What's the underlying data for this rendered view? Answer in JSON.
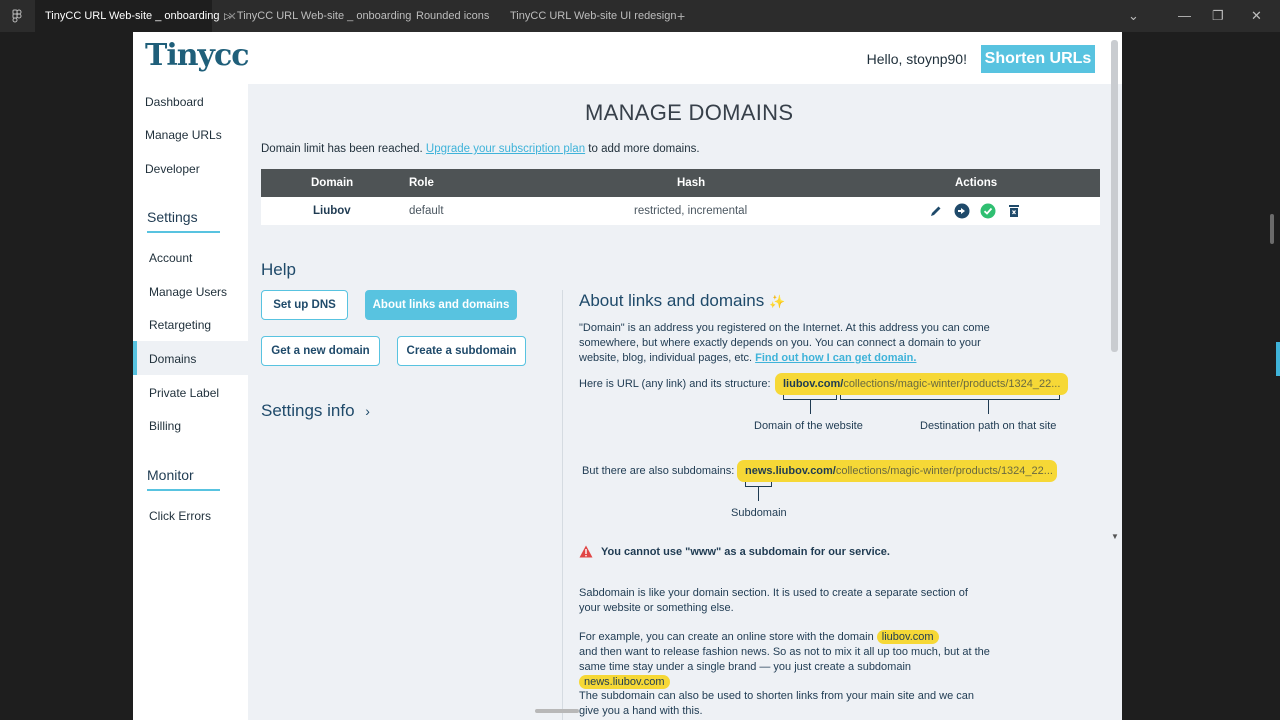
{
  "tabs": [
    {
      "label": "TinyCC URL Web-site _ onboarding",
      "active": true
    },
    {
      "label": "TinyCC URL Web-site _ onboarding",
      "active": false
    },
    {
      "label": "Rounded icons",
      "active": false
    },
    {
      "label": "TinyCC URL Web-site UI redesign",
      "active": false
    }
  ],
  "header": {
    "logo": "Tinycc",
    "greeting": "Hello, stoynp90!",
    "shorten_label": "Shorten URLs"
  },
  "sidebar": {
    "top_items": [
      "Dashboard",
      "Manage URLs",
      "Developer"
    ],
    "settings_title": "Settings",
    "settings_items": [
      "Account",
      "Manage Users",
      "Retargeting",
      "Domains",
      "Private Label",
      "Billing"
    ],
    "monitor_title": "Monitor",
    "monitor_items": [
      "Click Errors"
    ]
  },
  "main": {
    "title": "MANAGE DOMAINS",
    "notice_prefix": "Domain limit has been reached. ",
    "notice_link": "Upgrade your subscription plan",
    "notice_suffix": " to add more domains."
  },
  "table": {
    "headers": [
      "Domain",
      "Role",
      "Hash",
      "Actions"
    ],
    "rows": [
      {
        "domain": "Liubov",
        "role": "default",
        "hash": "restricted, incremental"
      }
    ]
  },
  "help": {
    "title": "Help",
    "buttons": [
      "Set up DNS",
      "About links and domains",
      "Get a new domain",
      "Create a subdomain"
    ],
    "settings_info": "Settings info"
  },
  "about": {
    "title": "About links and domains",
    "para1": "\"Domain\" is an address you registered on the Internet. At this address you can come somewhere, but where exactly depends on you. You can connect a domain to your website, blog, individual pages, etc.",
    "para1_link": "Find out how I can get domain.",
    "url_intro": "Here is URL (any link) and its structure:",
    "url_domain": "liubov.com/",
    "url_rest": "collections/magic-winter/products/1324_22...",
    "label_domain": "Domain of the website",
    "label_path": "Destination path on that site",
    "sub_intro": "But there are also subdomains:",
    "sub_domain": "news.liubov.com/",
    "sub_rest": "collections/magic-winter/products/1324_22...",
    "label_subdomain": "Subdomain",
    "warning": "You cannot use \"www\" as a subdomain for our service.",
    "para2": "Sabdomain is like your domain section. It is used to create a separate section of your website or something else.",
    "para3_a": "For example, you can create an online store with the domain",
    "para3_pill1": "liubov.com",
    "para3_b": "and then want to release fashion news. So as not to mix it all up too much, but at the same time stay under a single brand — you just create a subdomain",
    "para3_pill2": "news.liubov.com",
    "para4": "The subdomain can also be used to shorten links from your main site and we can give you a hand with this."
  },
  "colors": {
    "accent": "#58c3e0",
    "table_header": "#4e5355",
    "highlight": "#f6d836",
    "danger": "#e04646",
    "success": "#2fbf71"
  }
}
